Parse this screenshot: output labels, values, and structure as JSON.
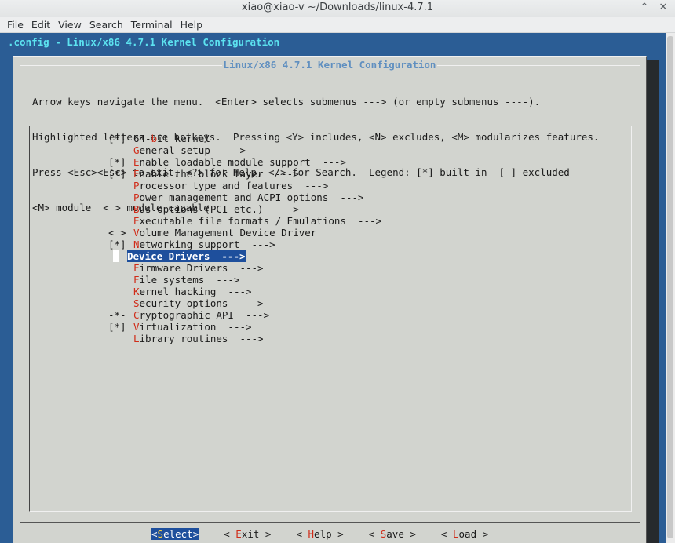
{
  "window": {
    "title": "xiao@xiao-v ~/Downloads/linux-4.7.1",
    "controls": [
      "chevron-up-icon",
      "close-icon"
    ]
  },
  "menubar": [
    "File",
    "Edit",
    "View",
    "Search",
    "Terminal",
    "Help"
  ],
  "terminal": {
    "backtitle": ".config - Linux/x86 4.7.1 Kernel Configuration",
    "dialog_title": "Linux/x86 4.7.1 Kernel Configuration",
    "help_lines": [
      "Arrow keys navigate the menu.  <Enter> selects submenus ---> (or empty submenus ----).",
      "Highlighted letters are hotkeys.  Pressing <Y> includes, <N> excludes, <M> modularizes features.",
      "Press <Esc><Esc> to exit, <?> for Help, </> for Search.  Legend: [*] built-in  [ ] excluded",
      "<M> module  < > module capable"
    ],
    "menu_items": [
      {
        "mark": "[*]",
        "pre": "64-",
        "hot": "b",
        "post": "it kernel"
      },
      {
        "mark": "",
        "pre": "",
        "hot": "G",
        "post": "eneral setup  --->"
      },
      {
        "mark": "[*]",
        "pre": "",
        "hot": "E",
        "post": "nable loadable module support  --->"
      },
      {
        "mark": "[*]",
        "pre": "",
        "hot": "E",
        "post": "nable the block layer  --->"
      },
      {
        "mark": "",
        "pre": "",
        "hot": "P",
        "post": "rocessor type and features  --->"
      },
      {
        "mark": "",
        "pre": "",
        "hot": "P",
        "post": "ower management and ACPI options  --->"
      },
      {
        "mark": "",
        "pre": "",
        "hot": "B",
        "post": "us options (PCI etc.)  --->"
      },
      {
        "mark": "",
        "pre": "",
        "hot": "E",
        "post": "xecutable file formats / Emulations  --->"
      },
      {
        "mark": "< >",
        "pre": "",
        "hot": "V",
        "post": "olume Management Device Driver"
      },
      {
        "mark": "[*]",
        "pre": "",
        "hot": "N",
        "post": "etworking support  --->"
      },
      {
        "mark": "",
        "pre": "",
        "hot": "D",
        "post": "evice Drivers  --->",
        "selected": true
      },
      {
        "mark": "",
        "pre": "",
        "hot": "F",
        "post": "irmware Drivers  --->"
      },
      {
        "mark": "",
        "pre": "",
        "hot": "F",
        "post": "ile systems  --->"
      },
      {
        "mark": "",
        "pre": "",
        "hot": "K",
        "post": "ernel hacking  --->"
      },
      {
        "mark": "",
        "pre": "",
        "hot": "S",
        "post": "ecurity options  --->"
      },
      {
        "mark": "-*-",
        "pre": "",
        "hot": "C",
        "post": "ryptographic API  --->"
      },
      {
        "mark": "[*]",
        "pre": "",
        "hot": "V",
        "post": "irtualization  --->"
      },
      {
        "mark": "",
        "pre": "",
        "hot": "L",
        "post": "ibrary routines  --->"
      }
    ],
    "buttons": [
      {
        "pre": "<",
        "hot": "S",
        "post": "elect>",
        "active": true
      },
      {
        "pre": "< ",
        "hot": "E",
        "post": "xit >"
      },
      {
        "pre": "< ",
        "hot": "H",
        "post": "elp >"
      },
      {
        "pre": "< ",
        "hot": "S",
        "post": "ave >"
      },
      {
        "pre": "< ",
        "hot": "L",
        "post": "oad >"
      }
    ]
  }
}
